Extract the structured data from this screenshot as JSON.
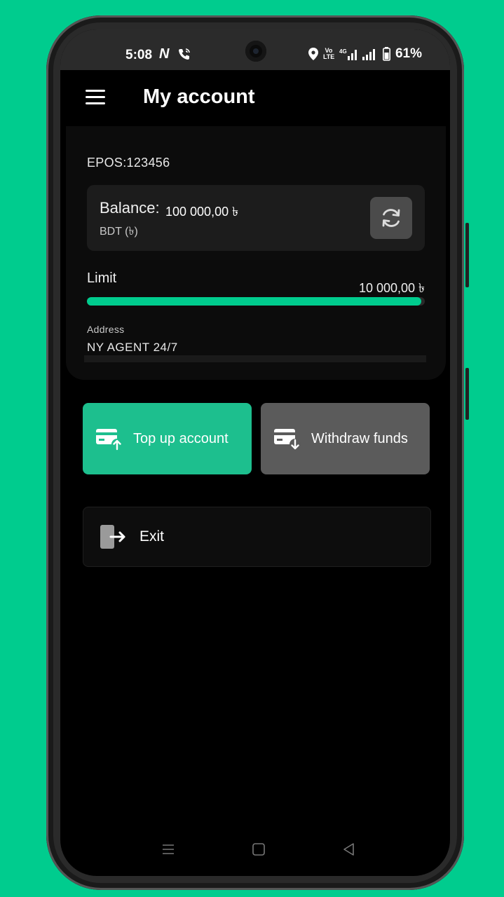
{
  "status_bar": {
    "time": "5:08",
    "carrier_icon": "N",
    "battery": "61%",
    "volte": "Vo\nLTE",
    "network": "4G"
  },
  "header": {
    "title": "My account",
    "menu_icon": "hamburger-menu-icon"
  },
  "account": {
    "epos": "EPOS:123456",
    "balance_label": "Balance:",
    "balance_value": "100 000,00 ৳",
    "currency": "BDT (৳)",
    "refresh_icon": "refresh-icon",
    "limit_label": "Limit",
    "limit_value": "10 000,00 ৳",
    "limit_progress": 0.99,
    "address_label": "Address",
    "address_value": "NY AGENT 24/7"
  },
  "actions": {
    "top_up_label": "Top up account",
    "withdraw_label": "Withdraw funds",
    "exit_label": "Exit"
  },
  "colors": {
    "accent": "#00cc8e",
    "topup_button": "#1dbf8e",
    "withdraw_button": "#5b5b5b"
  }
}
